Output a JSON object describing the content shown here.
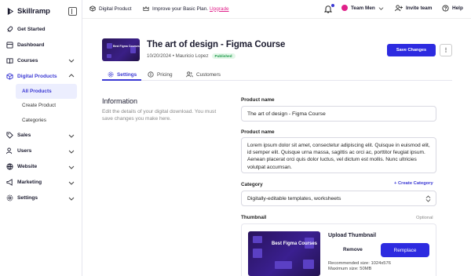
{
  "app": {
    "name": "Skillramp"
  },
  "sidebar": {
    "items": [
      {
        "label": "Get Started",
        "icon": "rocket-icon"
      },
      {
        "label": "Dashboard",
        "icon": "dashboard-icon"
      },
      {
        "label": "Courses",
        "icon": "book-icon"
      },
      {
        "label": "Digital Products",
        "icon": "box-icon"
      },
      {
        "label": "Sales",
        "icon": "tag-icon"
      },
      {
        "label": "Users",
        "icon": "users-icon"
      },
      {
        "label": "Website",
        "icon": "globe-icon"
      },
      {
        "label": "Marketing",
        "icon": "megaphone-icon"
      },
      {
        "label": "Settings",
        "icon": "gear-icon"
      }
    ],
    "sub_items": [
      {
        "label": "All Products"
      },
      {
        "label": "Create Product"
      },
      {
        "label": "Categories"
      }
    ]
  },
  "topbar": {
    "context": "Digital Product",
    "plan_text": "Improve your Basic Plan.",
    "upgrade": "Upgrade",
    "team": "Team Men",
    "invite": "Invite team",
    "help": "Help"
  },
  "product": {
    "title": "The art of design - Figma Course",
    "date": "10/20/2024",
    "author": "Mauricio Lopez",
    "status": "Published",
    "thumb_text": "Best Figma Courses"
  },
  "actions": {
    "save": "Save Changes",
    "more": "⋮"
  },
  "tabs": [
    {
      "label": "Settings"
    },
    {
      "label": "Pricing"
    },
    {
      "label": "Customers"
    }
  ],
  "info": {
    "heading": "Information",
    "desc": "Edit the details of your digital download. You must save changes you make here."
  },
  "form": {
    "name_label": "Product name",
    "name_value": "The art of design - Figma Course",
    "desc_label": "Product name",
    "desc_value": "Lorem ipsum dolor sit amet, consectetur adipiscing elit. Quisque in euismod elit, id semper elit. Quisque urna massa, sagittis ac orci ac, porttitor feugiat ipsum. Aenean placerat orci quis dolor luctus, vel dictum est mollis. Nunc ultricies volutpat accumsan.",
    "category_label": "Category",
    "create_category": "+ Create Category",
    "category_value": "Digitally-editable templates, worksheets",
    "thumbnail_label": "Thumbnail",
    "optional": "Optional"
  },
  "upload": {
    "title": "Upload Thumbnail",
    "remove": "Remove",
    "replace": "Remplace",
    "rec_size": "Recommended size: 1024x576",
    "max_size": "Maximum size: 50MB"
  },
  "colors": {
    "accent": "#2d2be0",
    "brand_pink": "#e0218a",
    "published": "#1f9a4b"
  }
}
